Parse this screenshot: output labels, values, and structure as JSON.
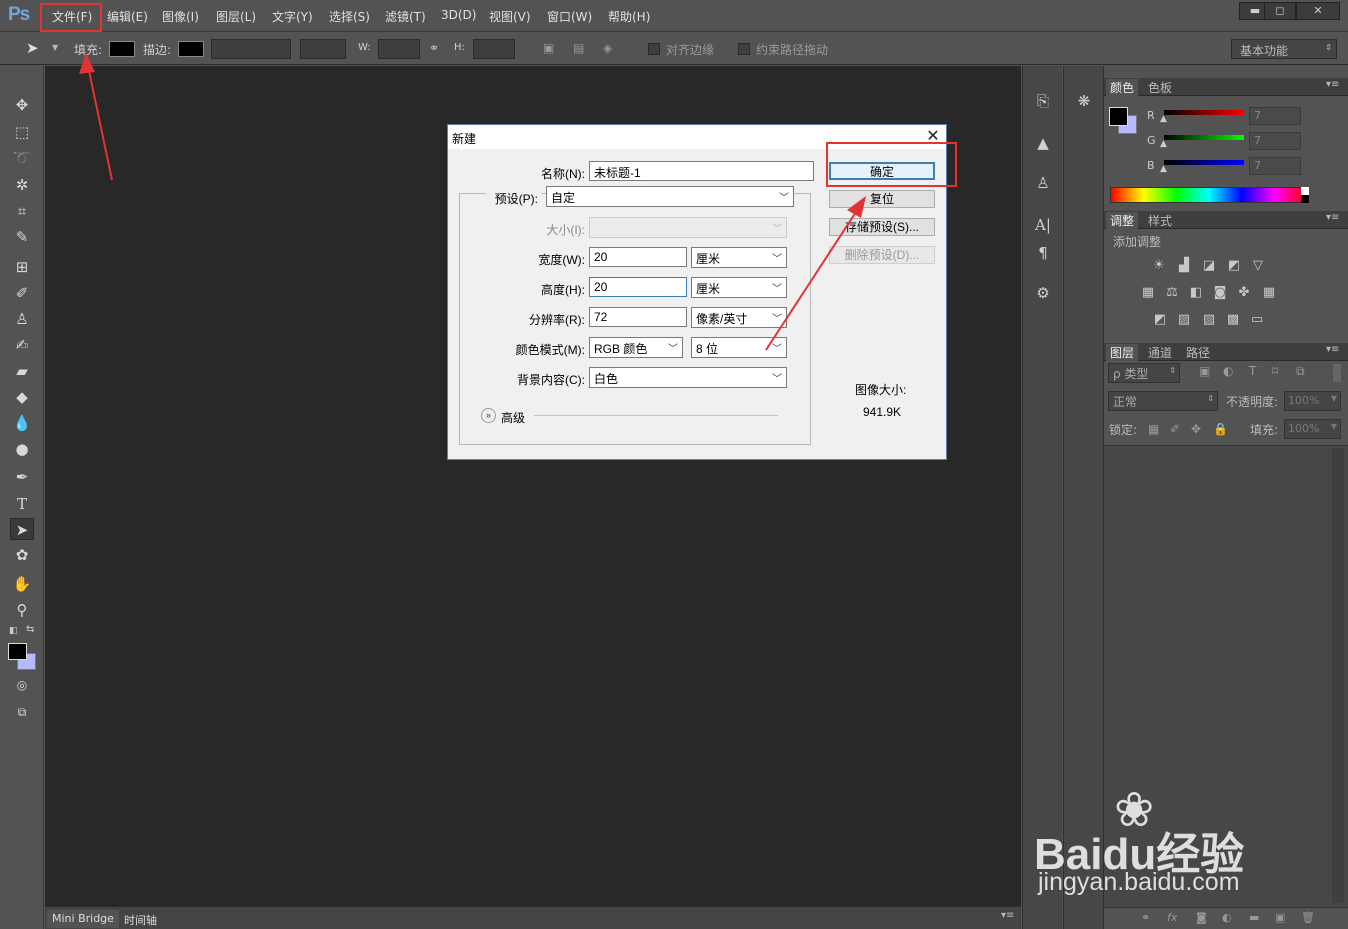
{
  "app": {
    "logo": "Ps"
  },
  "menu": [
    "文件(F)",
    "编辑(E)",
    "图像(I)",
    "图层(L)",
    "文字(Y)",
    "选择(S)",
    "滤镜(T)",
    "3D(D)",
    "视图(V)",
    "窗口(W)",
    "帮助(H)"
  ],
  "window_controls": {
    "minimize": "▬",
    "maximize": "◻",
    "close": "✕"
  },
  "options": {
    "fill_label": "填充:",
    "stroke_label": "描边:",
    "w_label": "W:",
    "h_label": "H:",
    "align_edges": "对齐边缘",
    "constrain_path": "约束路径拖动",
    "workspace": "基本功能"
  },
  "bottom_tabs": [
    "Mini Bridge",
    "时间轴"
  ],
  "color_panel": {
    "tabs": [
      "颜色",
      "色板"
    ],
    "r_label": "R",
    "g_label": "G",
    "b_label": "B",
    "r_value": "7",
    "g_value": "7",
    "b_value": "7"
  },
  "adjust_panel": {
    "tabs": [
      "调整",
      "样式"
    ],
    "title": "添加调整"
  },
  "layers_panel": {
    "tabs": [
      "图层",
      "通道",
      "路径"
    ],
    "filter": "ρ 类型",
    "blend_mode": "正常",
    "opacity_label": "不透明度:",
    "opacity_value": "100%",
    "lock_label": "锁定:",
    "fill_label": "填充:",
    "fill_value": "100%"
  },
  "dialog": {
    "title": "新建",
    "name_label": "名称(N):",
    "name_value": "未标题-1",
    "preset_label": "预设(P):",
    "preset_value": "自定",
    "size_label": "大小(I):",
    "width_label": "宽度(W):",
    "width_value": "20",
    "width_unit": "厘米",
    "height_label": "高度(H):",
    "height_value": "20",
    "height_unit": "厘米",
    "resolution_label": "分辨率(R):",
    "resolution_value": "72",
    "resolution_unit": "像素/英寸",
    "color_mode_label": "颜色模式(M):",
    "color_mode_value": "RGB 颜色",
    "bit_depth": "8 位",
    "background_label": "背景内容(C):",
    "background_value": "白色",
    "advanced": "高级",
    "ok": "确定",
    "reset": "复位",
    "save_preset": "存储预设(S)...",
    "delete_preset": "删除预设(D)...",
    "image_size_label": "图像大小:",
    "image_size_value": "941.9K"
  },
  "watermark": {
    "brand": "Baidu经验",
    "url": "jingyan.baidu.com"
  },
  "colors": {
    "annotation_red": "#e23434",
    "ps_blue": "#6ea6e0",
    "canvas": "#282828"
  }
}
